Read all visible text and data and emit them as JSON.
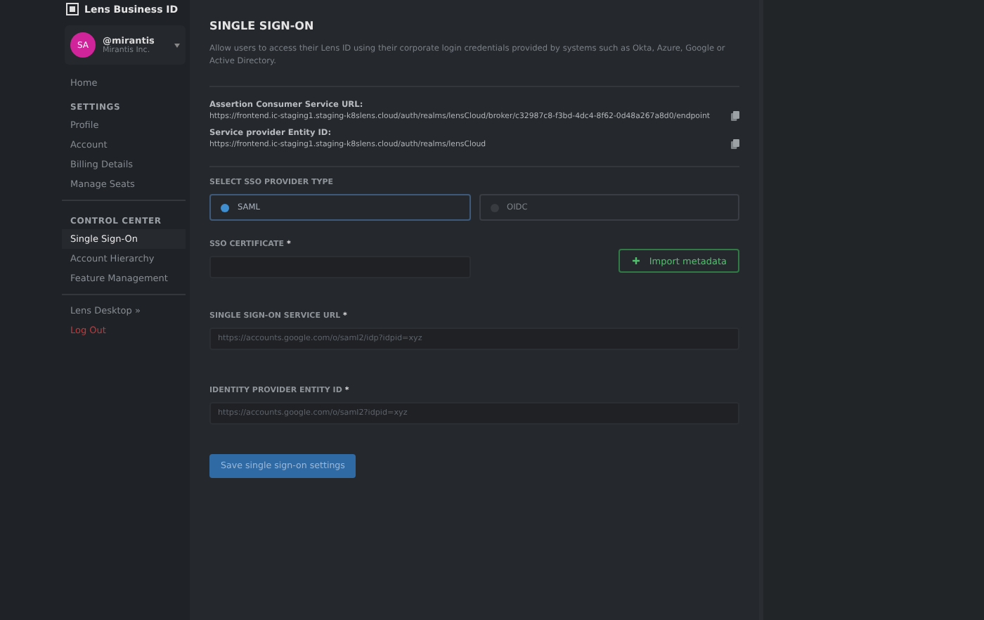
{
  "brand": {
    "name": "Lens Business ID"
  },
  "account": {
    "initials": "SA",
    "handle": "@mirantis",
    "org": "Mirantis Inc."
  },
  "nav": [
    {
      "kind": "link",
      "label": "Home",
      "selected": false
    },
    {
      "kind": "heading",
      "label": "SETTINGS"
    },
    {
      "kind": "link",
      "label": "Profile",
      "selected": false
    },
    {
      "kind": "link",
      "label": "Account",
      "selected": false
    },
    {
      "kind": "link",
      "label": "Billing Details",
      "selected": false
    },
    {
      "kind": "link",
      "label": "Manage Seats",
      "selected": false
    },
    {
      "kind": "divider"
    },
    {
      "kind": "heading",
      "label": "CONTROL CENTER"
    },
    {
      "kind": "link",
      "label": "Single Sign-On",
      "selected": true
    },
    {
      "kind": "link",
      "label": "Account Hierarchy",
      "selected": false
    },
    {
      "kind": "link",
      "label": "Feature Management",
      "selected": false
    },
    {
      "kind": "divider"
    },
    {
      "kind": "link",
      "label": "Lens Desktop »",
      "selected": false
    },
    {
      "kind": "danger",
      "label": "Log Out"
    }
  ],
  "page": {
    "title": "SINGLE SIGN-ON",
    "description": "Allow users to access their Lens ID using their corporate login credentials provided by systems such as Okta, Azure, Google or Active Directory.",
    "info": [
      {
        "label": "Assertion Consumer Service URL:",
        "value": "https://frontend.ic-staging1.staging-k8slens.cloud/auth/realms/lensCloud/broker/c32987c8-f3bd-4dc4-8f62-0d48a267a8d0/endpoint"
      },
      {
        "label": "Service provider Entity ID:",
        "value": "https://frontend.ic-staging1.staging-k8slens.cloud/auth/realms/lensCloud"
      }
    ],
    "provider_label": "SELECT SSO PROVIDER TYPE",
    "providers": [
      {
        "label": "SAML",
        "selected": true
      },
      {
        "label": "OIDC",
        "selected": false
      }
    ],
    "certificate": {
      "label": "SSO CERTIFICATE",
      "required_mark": "*"
    },
    "import_button": "Import metadata",
    "fields": [
      {
        "label": "SINGLE SIGN-ON SERVICE URL",
        "required_mark": "*",
        "placeholder": "https://accounts.google.com/o/saml2/idp?idpid=xyz"
      },
      {
        "label": "IDENTITY PROVIDER ENTITY ID",
        "required_mark": "*",
        "placeholder": "https://accounts.google.com/o/saml2?idpid=xyz"
      }
    ],
    "save_button": "Save single sign-on settings"
  }
}
